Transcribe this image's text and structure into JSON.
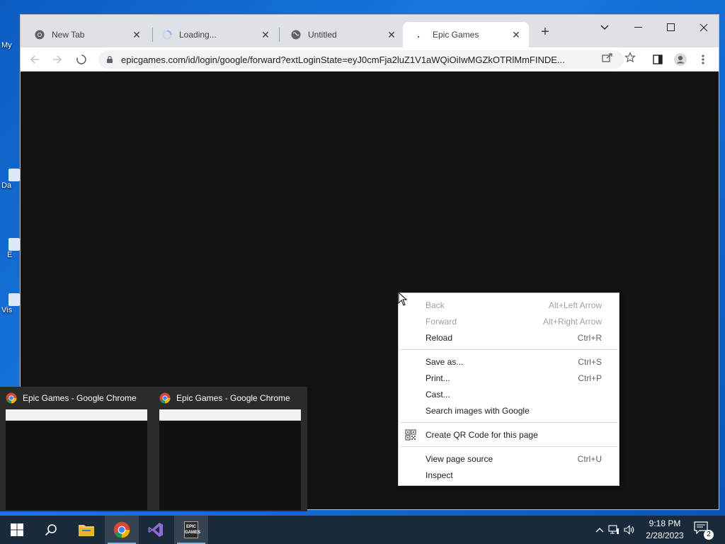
{
  "desktop": {
    "icons": [
      "My",
      "Da",
      "E",
      "Vis"
    ]
  },
  "browser": {
    "tabs": [
      {
        "title": "New Tab",
        "favicon": "chrome-icon"
      },
      {
        "title": "Loading...",
        "favicon": "loading-spinner-icon"
      },
      {
        "title": "Untitled",
        "favicon": "globe-icon"
      },
      {
        "title": "Epic Games",
        "favicon": "loading-dot-icon",
        "active": true
      }
    ],
    "url": "epicgames.com/id/login/google/forward?extLoginState=eyJ0cmFja2luZ1V1aWQiOiIwMGZkOTRlMmFINDE...",
    "page_background": "#121212"
  },
  "context_menu": {
    "items": [
      {
        "label": "Back",
        "shortcut": "Alt+Left Arrow",
        "disabled": true
      },
      {
        "label": "Forward",
        "shortcut": "Alt+Right Arrow",
        "disabled": true
      },
      {
        "label": "Reload",
        "shortcut": "Ctrl+R"
      },
      {
        "label": "Save as...",
        "shortcut": "Ctrl+S"
      },
      {
        "label": "Print...",
        "shortcut": "Ctrl+P"
      },
      {
        "label": "Cast...",
        "shortcut": ""
      },
      {
        "label": "Search images with Google",
        "shortcut": ""
      },
      {
        "label": "Create QR Code for this page",
        "shortcut": "",
        "icon": "qr-code-icon"
      },
      {
        "label": "View page source",
        "shortcut": "Ctrl+U"
      },
      {
        "label": "Inspect",
        "shortcut": ""
      }
    ]
  },
  "thumbnails": [
    {
      "title": "Epic Games - Google Chrome"
    },
    {
      "title": "Epic Games - Google Chrome"
    }
  ],
  "taskbar": {
    "time": "9:18 PM",
    "date": "2/28/2023",
    "notification_count": "2",
    "epic_label": "EPIC\nGAMES"
  }
}
